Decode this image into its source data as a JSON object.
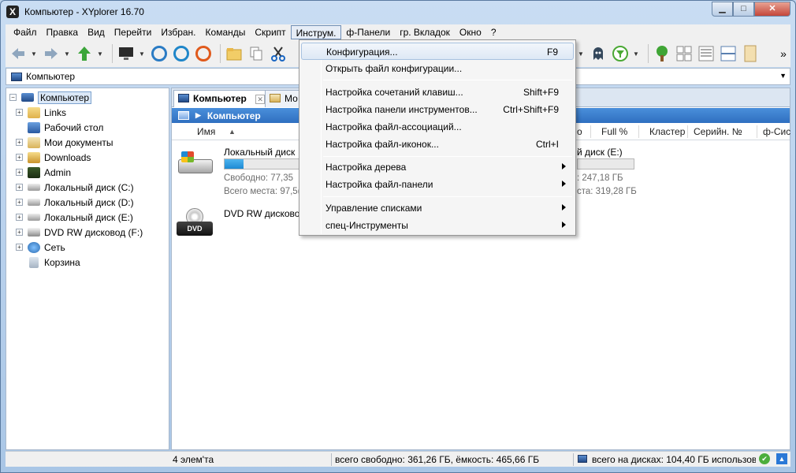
{
  "window": {
    "title": "Компьютер - XYplorer 16.70",
    "min_glyph": "▁",
    "max_glyph": "□",
    "close_glyph": "✕"
  },
  "menubar": [
    {
      "label": "Файл"
    },
    {
      "label": "Правка"
    },
    {
      "label": "Вид"
    },
    {
      "label": "Перейти"
    },
    {
      "label": "Избран."
    },
    {
      "label": "Команды"
    },
    {
      "label": "Скрипт"
    },
    {
      "label": "Инструм.",
      "active": true
    },
    {
      "label": "ф-Панели"
    },
    {
      "label": "гр. Вкладок"
    },
    {
      "label": "Окно"
    },
    {
      "label": "?"
    }
  ],
  "toolbar": {
    "back_icon": "arrow-left-icon",
    "forward_icon": "arrow-right-icon",
    "up_icon": "arrow-up-icon",
    "more_glyph": "»"
  },
  "address": {
    "value": "Компьютер",
    "drop_glyph": "▼"
  },
  "tree": [
    {
      "label": "Компьютер",
      "expander": "−",
      "icon": "computer",
      "root": true,
      "indent": 0
    },
    {
      "label": "Links",
      "expander": "+",
      "icon": "folder",
      "indent": 1
    },
    {
      "label": "Рабочий стол",
      "expander": "",
      "icon": "desktop",
      "indent": 1
    },
    {
      "label": "Мои документы",
      "expander": "+",
      "icon": "docs",
      "indent": 1
    },
    {
      "label": "Downloads",
      "expander": "+",
      "icon": "dl",
      "indent": 1
    },
    {
      "label": "Admin",
      "expander": "+",
      "icon": "user",
      "indent": 1
    },
    {
      "label": "Локальный диск (C:)",
      "expander": "+",
      "icon": "drive",
      "indent": 1
    },
    {
      "label": "Локальный диск (D:)",
      "expander": "+",
      "icon": "drive",
      "indent": 1
    },
    {
      "label": "Локальный диск (E:)",
      "expander": "+",
      "icon": "drive",
      "indent": 1
    },
    {
      "label": "DVD RW дисковод (F:)",
      "expander": "+",
      "icon": "dvd",
      "indent": 1
    },
    {
      "label": "Сеть",
      "expander": "+",
      "icon": "net",
      "indent": 1
    },
    {
      "label": "Корзина",
      "expander": "",
      "icon": "bin",
      "indent": 1
    }
  ],
  "tabs": [
    {
      "label": "Компьютер",
      "close": "✕",
      "active": true
    },
    {
      "label": "Мо",
      "active": false
    }
  ],
  "breadcrumb": {
    "arrow": "▶",
    "label": "Компьютер"
  },
  "columns": {
    "name": "Имя",
    "sort_glyph": "▲",
    "partial": "о",
    "full_percent": "Full %",
    "cluster": "Кластер",
    "serial": "Серийн. №",
    "fs": "ф-Сис"
  },
  "drives": {
    "c": {
      "name": "Локальный диск",
      "used_fraction": 0.2,
      "free": "Свободно: 77,35",
      "total": "Всего места: 97,5("
    },
    "e": {
      "name": "й диск (E:)",
      "used_fraction": 0,
      "free": ": 247,18 ГБ",
      "total": "ста: 319,28 ГБ"
    },
    "f": {
      "name": "DVD RW дисковод",
      "icon_label": "DVD"
    }
  },
  "statusbar": {
    "count": "4 элем'та",
    "free_total": "всего свободно: 361,26 ГБ, ёмкость: 465,66 ГБ",
    "used_total": "всего на дисках: 104,40 ГБ использова",
    "ok_glyph": "✔",
    "up_glyph": "▲"
  },
  "tools_menu": [
    {
      "label": "Конфигурация...",
      "shortcut": "F9",
      "highlight": true
    },
    {
      "label": "Открыть файл конфигурации...",
      "shortcut": ""
    },
    {
      "separator": true
    },
    {
      "label": "Настройка сочетаний клавиш...",
      "shortcut": "Shift+F9"
    },
    {
      "label": "Настройка панели инструментов...",
      "shortcut": "Ctrl+Shift+F9"
    },
    {
      "label": "Настройка файл-ассоциаций...",
      "shortcut": ""
    },
    {
      "label": "Настройка файл-иконок...",
      "shortcut": "Ctrl+I"
    },
    {
      "separator": true
    },
    {
      "label": "Настройка дерева",
      "submenu": true
    },
    {
      "label": "Настройка файл-панели",
      "submenu": true
    },
    {
      "separator": true
    },
    {
      "label": "Управление списками",
      "submenu": true
    },
    {
      "label": "спец-Инструменты",
      "submenu": true
    }
  ]
}
